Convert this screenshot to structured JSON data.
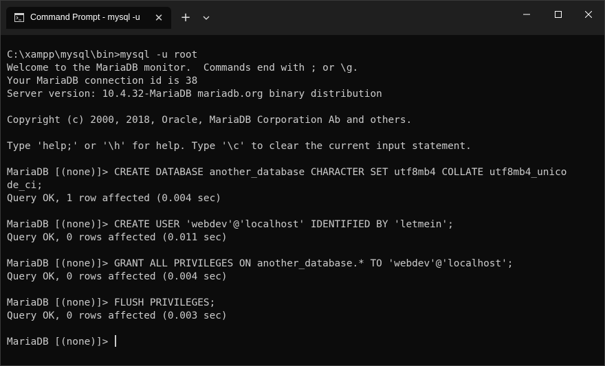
{
  "window": {
    "tab_title": "Command Prompt - mysql  -u",
    "tab_close": "✕",
    "new_tab": "+"
  },
  "terminal": {
    "lines": [
      "C:\\xampp\\mysql\\bin>mysql -u root",
      "Welcome to the MariaDB monitor.  Commands end with ; or \\g.",
      "Your MariaDB connection id is 38",
      "Server version: 10.4.32-MariaDB mariadb.org binary distribution",
      "",
      "Copyright (c) 2000, 2018, Oracle, MariaDB Corporation Ab and others.",
      "",
      "Type 'help;' or '\\h' for help. Type '\\c' to clear the current input statement.",
      "",
      "MariaDB [(none)]> CREATE DATABASE another_database CHARACTER SET utf8mb4 COLLATE utf8mb4_unico",
      "de_ci;",
      "Query OK, 1 row affected (0.004 sec)",
      "",
      "MariaDB [(none)]> CREATE USER 'webdev'@'localhost' IDENTIFIED BY 'letmein';",
      "Query OK, 0 rows affected (0.011 sec)",
      "",
      "MariaDB [(none)]> GRANT ALL PRIVILEGES ON another_database.* TO 'webdev'@'localhost';",
      "Query OK, 0 rows affected (0.004 sec)",
      "",
      "MariaDB [(none)]> FLUSH PRIVILEGES;",
      "Query OK, 0 rows affected (0.003 sec)",
      "",
      "MariaDB [(none)]> "
    ]
  },
  "colors": {
    "background": "#0c0c0c",
    "titlebar": "#1f1f1f",
    "text": "#cccccc"
  }
}
